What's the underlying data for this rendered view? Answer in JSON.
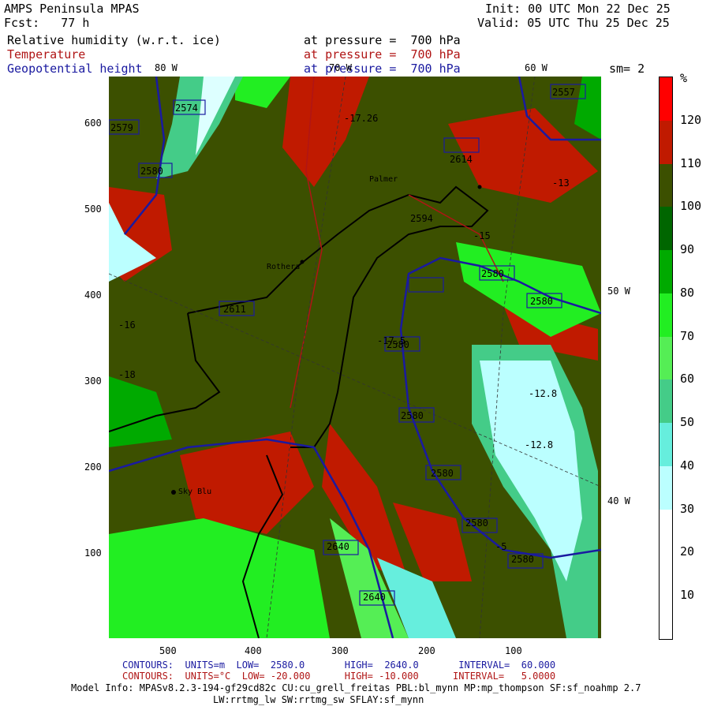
{
  "header": {
    "title": "AMPS Peninsula MPAS",
    "forecast": "Fcst:   77 h",
    "init": "Init: 00 UTC Mon 22 Dec 25",
    "valid": "Valid: 05 UTC Thu 25 Dec 25",
    "fields": [
      {
        "name": "Relative humidity (w.r.t. ice)",
        "level": "at pressure =  700 hPa",
        "color": "#000000"
      },
      {
        "name": "Temperature",
        "level": "at pressure =  700 hPa",
        "color": "#b01515"
      },
      {
        "name": "Geopotential height",
        "level": "at pressure =  700 hPa",
        "color": "#1a1aa0"
      }
    ],
    "smoothing": "sm= 2"
  },
  "colorbar": {
    "unit": "%",
    "labels": [
      "120",
      "110",
      "100",
      "90",
      "80",
      "70",
      "60",
      "50",
      "40",
      "30",
      "20",
      "10"
    ],
    "colors": [
      "#ff0000",
      "#c01a00",
      "#3c5000",
      "#006600",
      "#00aa00",
      "#22ee22",
      "#55ee55",
      "#44cc88",
      "#66eedd",
      "#bbffff",
      "#ffffff",
      "#ffffff",
      "#ffffff"
    ]
  },
  "axes": {
    "x_ticks": [
      "500",
      "400",
      "300",
      "200",
      "100"
    ],
    "y_ticks": [
      "600",
      "500",
      "400",
      "300",
      "200",
      "100"
    ],
    "longitude_labels": [
      "80 W",
      "70 W",
      "60 W",
      "50 W",
      "40 W"
    ]
  },
  "place_labels": [
    "Palmer",
    "Rothera",
    "Sky Blu"
  ],
  "height_contour_labels": [
    "2574",
    "2557",
    "2579",
    "2580",
    "2580",
    "2580",
    "2580",
    "2580",
    "2580",
    "2580",
    "2580",
    "2640",
    "2640",
    "2611",
    "2614",
    "2594"
  ],
  "temp_contour_labels": [
    "-17.26",
    "-17.5",
    "-13",
    "-12.8",
    "-12.8",
    "-15",
    "-16",
    "-18",
    "-5"
  ],
  "footer": {
    "contours_height": "CONTOURS:  UNITS=m  LOW=  2580.0       HIGH=  2640.0       INTERVAL=  60.000",
    "contours_temp": "CONTOURS:  UNITS=°C  LOW= -20.000      HIGH= -10.000      INTERVAL=   5.0000",
    "model_info_1": "Model Info: MPASv8.2.3-194-gf29cd82c CU:cu_grell_freitas PBL:bl_mynn MP:mp_thompson SF:sf_noahmp 2.7",
    "model_info_2": "LW:rrtmg_lw SW:rrtmg_sw SFLAY:sf_mynn"
  }
}
